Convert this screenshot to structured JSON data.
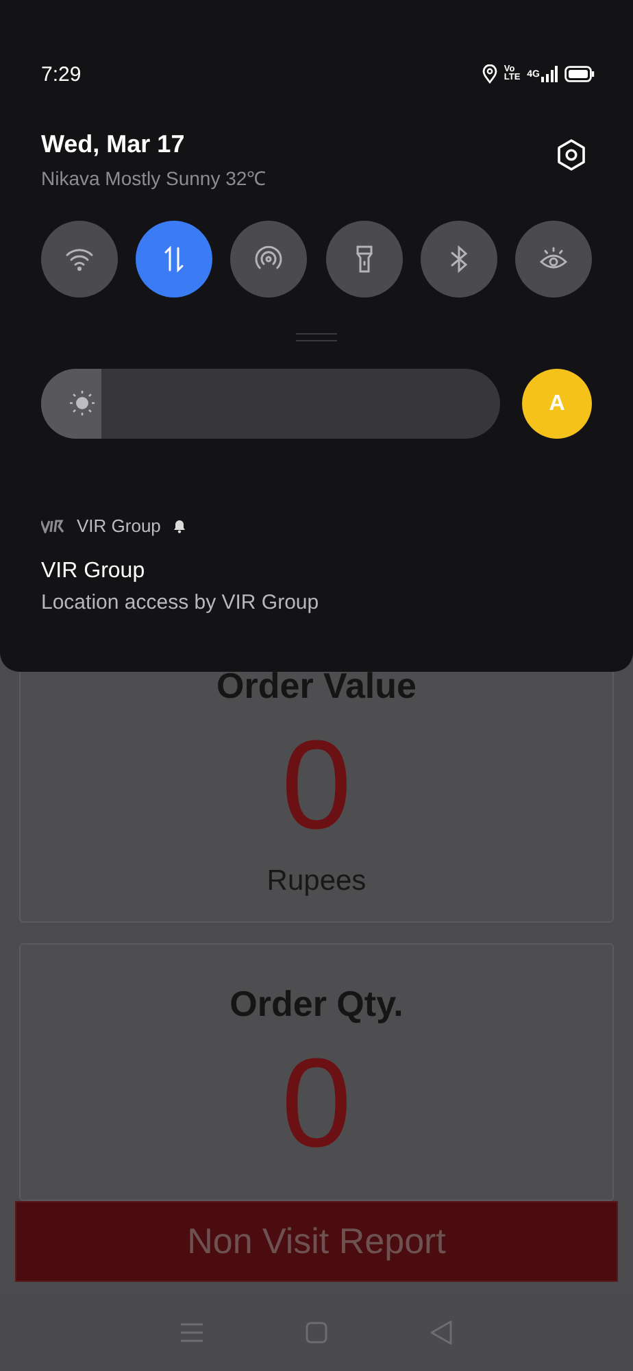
{
  "status_bar": {
    "time": "7:29",
    "volte_top": "Vo",
    "volte_bottom": "LTE",
    "network": "4G"
  },
  "panel": {
    "date": "Wed, Mar 17",
    "weather": "Nikava Mostly Sunny 32℃",
    "toggles": [
      {
        "kind": "wifi",
        "on": false
      },
      {
        "kind": "data",
        "on": true
      },
      {
        "kind": "hotspot",
        "on": false
      },
      {
        "kind": "flashlight",
        "on": false
      },
      {
        "kind": "bluetooth",
        "on": false
      },
      {
        "kind": "eye",
        "on": false
      }
    ],
    "brightness": {
      "level": 0.13,
      "auto_label": "A",
      "auto": true
    },
    "notification": {
      "app": "VIR Group",
      "title": "VIR Group",
      "text": "Location access by VIR Group"
    }
  },
  "cards": [
    {
      "title": "Order Value",
      "value": "0",
      "unit": "Rupees"
    },
    {
      "title": "Order Qty.",
      "value": "0"
    }
  ],
  "button": "Non Visit Report"
}
